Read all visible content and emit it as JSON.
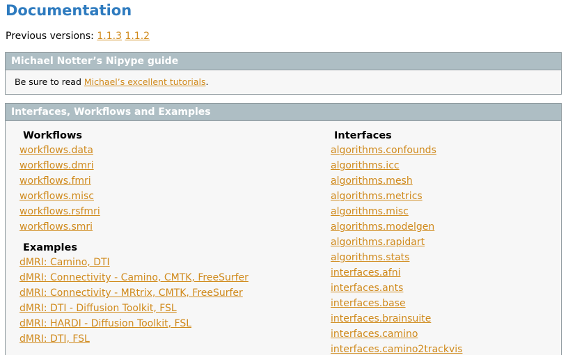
{
  "header": {
    "title": "Documentation",
    "previous_versions_label": "Previous versions:",
    "versions": [
      "1.1.3",
      "1.1.2"
    ]
  },
  "guide_box": {
    "title": "Michael Notter’s Nipype guide",
    "text_before": "Be sure to read ",
    "link_text": "Michael’s excellent tutorials",
    "text_after": "."
  },
  "iwe_box": {
    "title": "Interfaces, Workflows and Examples",
    "workflows": {
      "title": "Workflows",
      "items": [
        "workflows.data",
        "workflows.dmri",
        "workflows.fmri",
        "workflows.misc",
        "workflows.rsfmri",
        "workflows.smri"
      ]
    },
    "examples": {
      "title": "Examples",
      "items": [
        "dMRI: Camino, DTI",
        "dMRI: Connectivity - Camino, CMTK, FreeSurfer",
        "dMRI: Connectivity - MRtrix, CMTK, FreeSurfer",
        "dMRI: DTI - Diffusion Toolkit, FSL",
        "dMRI: HARDI - Diffusion Toolkit, FSL",
        "dMRI: DTI, FSL"
      ]
    },
    "interfaces": {
      "title": "Interfaces",
      "items": [
        "algorithms.confounds",
        "algorithms.icc",
        "algorithms.mesh",
        "algorithms.metrics",
        "algorithms.misc",
        "algorithms.modelgen",
        "algorithms.rapidart",
        "algorithms.stats",
        "interfaces.afni",
        "interfaces.ants",
        "interfaces.base",
        "interfaces.brainsuite",
        "interfaces.camino",
        "interfaces.camino2trackvis"
      ]
    }
  },
  "colors": {
    "title": "#2e7bbf",
    "link": "#d08a1c",
    "box_header": "#aebec4",
    "box_bg": "#f7f7f7"
  }
}
